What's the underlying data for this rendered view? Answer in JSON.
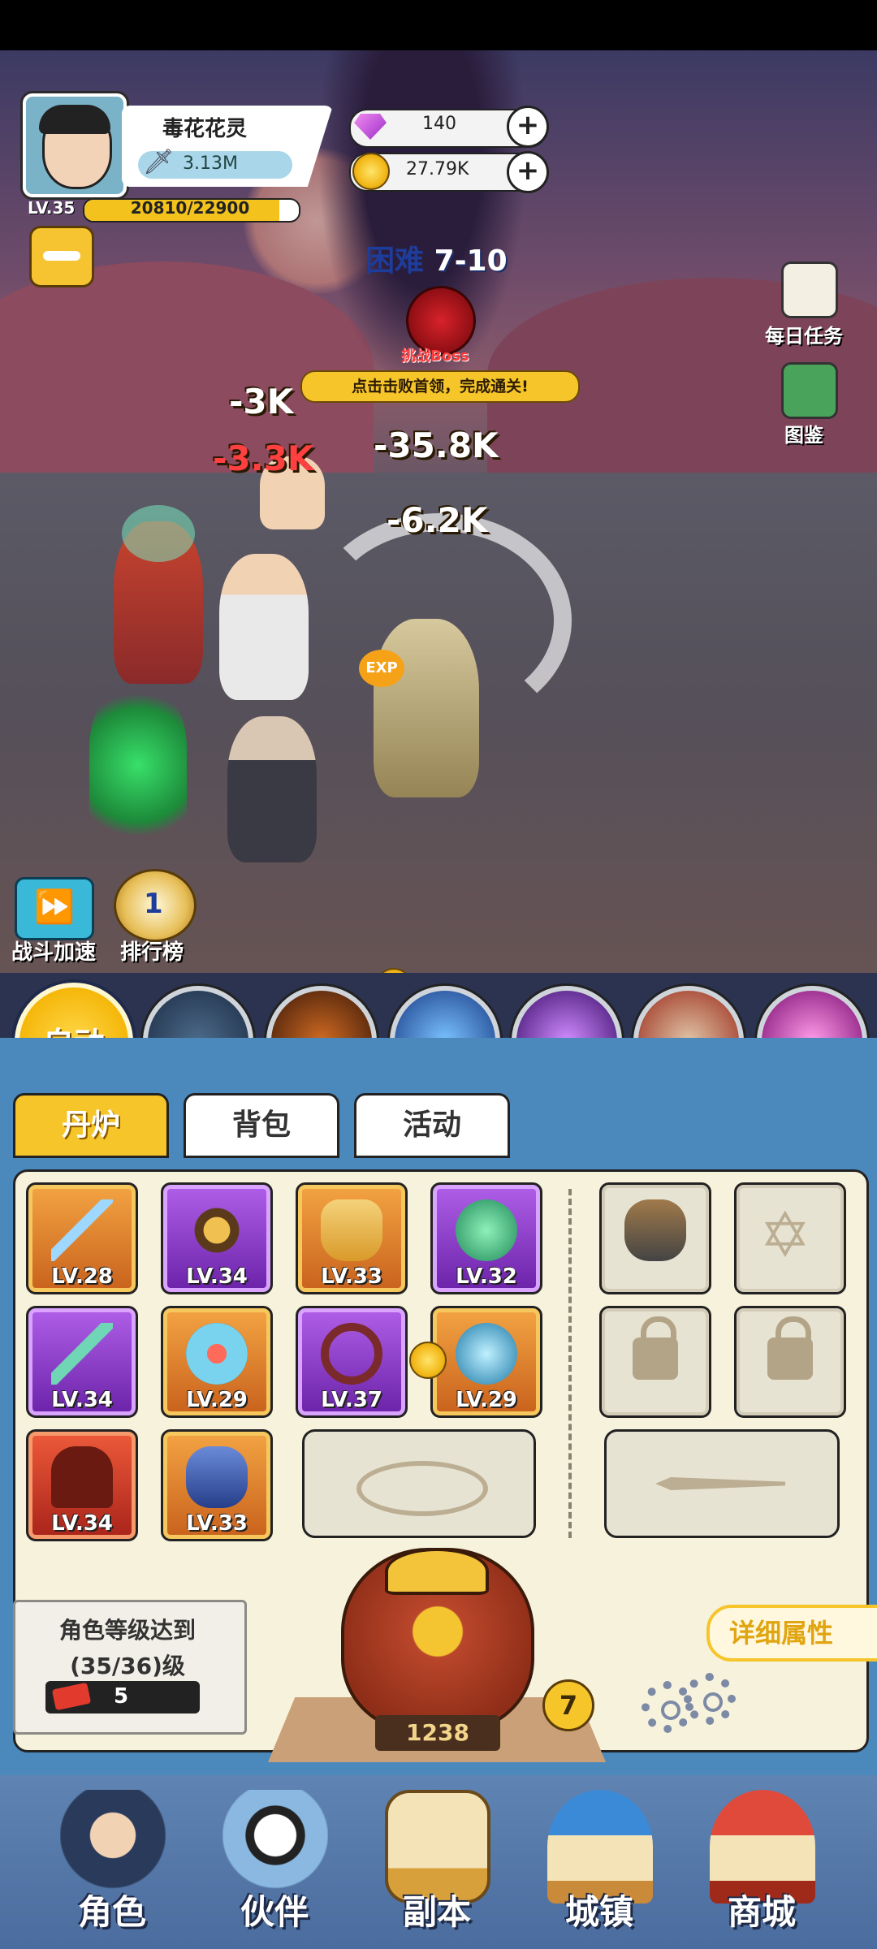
{
  "player": {
    "name": "毒花花灵",
    "power": "3.13M",
    "level": "LV.35",
    "xp_text": "20810/22900",
    "xp_fraction": 0.909
  },
  "currency": {
    "gems": "140",
    "coins": "27.79K"
  },
  "stage": {
    "difficulty": "困难",
    "number": "7-10",
    "boss_label": "挑战Boss",
    "tip": "点击击败首领，完成通关!"
  },
  "side_menu": {
    "daily_tasks": "每日任务",
    "codex": "图鉴"
  },
  "damage_numbers": [
    "-3K",
    "-3.3K",
    "-35.8K",
    "-6.2K"
  ],
  "scene_buttons": {
    "battle_speed": "战斗加速",
    "leaderboard": "排行榜"
  },
  "skill_bar": {
    "auto_label": "自动",
    "skills": [
      "lightning-skill",
      "warrior-skill",
      "fireball-skill",
      "shuriken-skill",
      "beast-skill",
      "vortex-skill"
    ]
  },
  "tabs": [
    {
      "label": "丹炉",
      "active": true
    },
    {
      "label": "背包",
      "active": false
    },
    {
      "label": "活动",
      "active": false
    }
  ],
  "equipment": [
    {
      "icon": "sword-icon",
      "level": "LV.28",
      "rarity": "orange"
    },
    {
      "icon": "armor-icon",
      "level": "LV.34",
      "rarity": "purple"
    },
    {
      "icon": "chestplate-icon",
      "level": "LV.33",
      "rarity": "orange"
    },
    {
      "icon": "jade-orb-icon",
      "level": "LV.32",
      "rarity": "purple"
    },
    {
      "icon": "blade-icon",
      "level": "LV.34",
      "rarity": "purple"
    },
    {
      "icon": "shield-icon",
      "level": "LV.29",
      "rarity": "orange"
    },
    {
      "icon": "whip-icon",
      "level": "LV.37",
      "rarity": "purple"
    },
    {
      "icon": "water-orb-icon",
      "level": "LV.29",
      "rarity": "orange"
    },
    {
      "icon": "helmet-icon",
      "level": "LV.34",
      "rarity": "red"
    },
    {
      "icon": "boots-icon",
      "level": "LV.33",
      "rarity": "orange"
    }
  ],
  "level_requirement": {
    "line1": "角色等级达到",
    "line2": "(35/36)级",
    "tickets": "5"
  },
  "furnace": {
    "count": "1238",
    "badge": "7"
  },
  "detail_button": "详细属性",
  "nav": [
    {
      "label": "角色"
    },
    {
      "label": "伙伴"
    },
    {
      "label": "副本"
    },
    {
      "label": "城镇"
    },
    {
      "label": "商城"
    }
  ],
  "colors": {
    "accent_yellow": "#f5c52a",
    "panel_bg": "#f7f2dc",
    "nav_blue": "#4a6c9e"
  }
}
